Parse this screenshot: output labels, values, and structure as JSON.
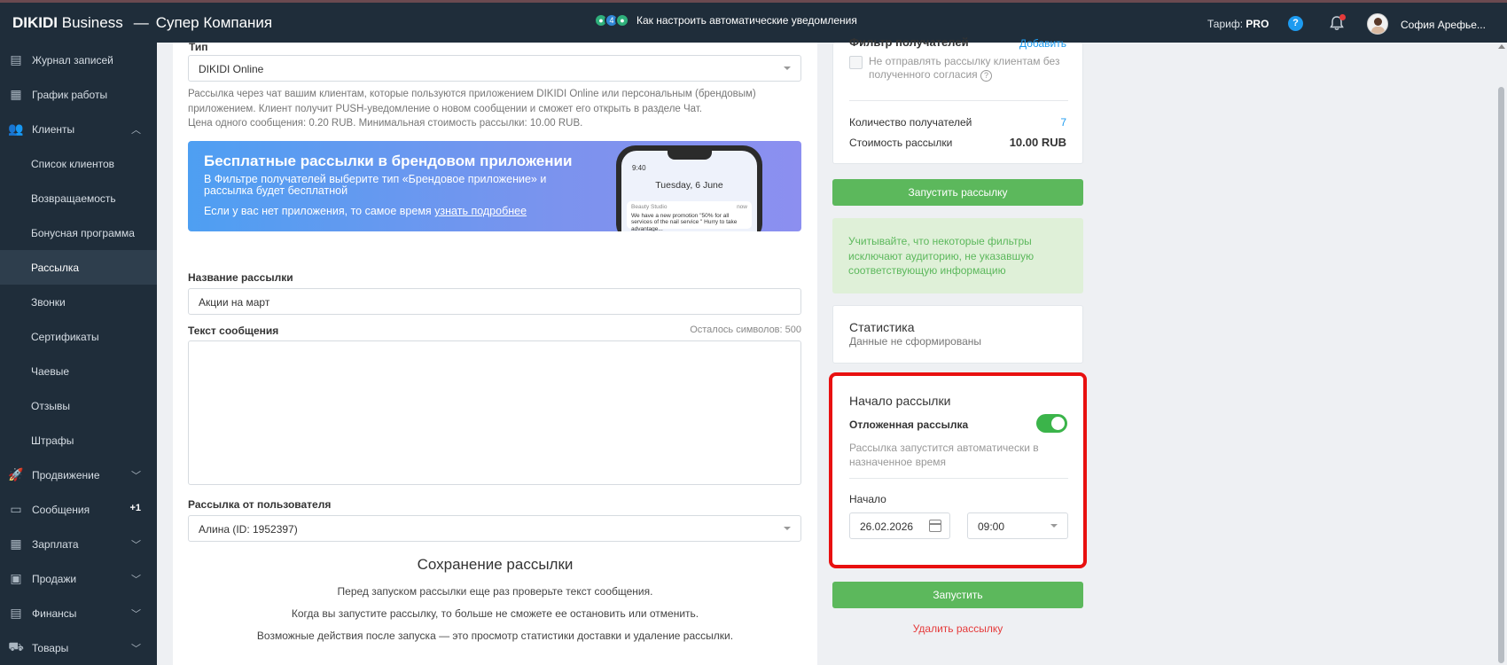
{
  "header": {
    "brand_bold": "DIKIDI",
    "brand_rest": "Business",
    "separator": "—",
    "company": "Супер Компания",
    "hint_text": "Как настроить автоматические уведомления",
    "tariff_label": "Тариф:",
    "tariff_value": "PRO",
    "help_glyph": "?",
    "user_name": "София Арефье..."
  },
  "sidebar": {
    "items": [
      {
        "label": "Журнал записей",
        "icon": "journal-icon"
      },
      {
        "label": "График работы",
        "icon": "calendar-icon"
      },
      {
        "label": "Клиенты",
        "icon": "clients-icon"
      },
      {
        "label": "Список клиентов"
      },
      {
        "label": "Возвращаемость"
      },
      {
        "label": "Бонусная программа"
      },
      {
        "label": "Рассылка"
      },
      {
        "label": "Звонки"
      },
      {
        "label": "Сертификаты"
      },
      {
        "label": "Чаевые"
      },
      {
        "label": "Отзывы"
      },
      {
        "label": "Штрафы"
      },
      {
        "label": "Продвижение",
        "icon": "rocket-icon"
      },
      {
        "label": "Сообщения",
        "icon": "messages-icon",
        "badge": "+1"
      },
      {
        "label": "Зарплата",
        "icon": "salary-icon"
      },
      {
        "label": "Продажи",
        "icon": "sales-icon"
      },
      {
        "label": "Финансы",
        "icon": "finance-icon"
      },
      {
        "label": "Товары",
        "icon": "goods-icon"
      }
    ]
  },
  "main": {
    "type_label": "Тип",
    "type_value": "DIKIDI Online",
    "type_desc_1": "Рассылка через чат вашим клиентам, которые пользуются приложением DIKIDI Online или персональным (брендовым) приложением. Клиент получит PUSH-уведомление о новом сообщении и сможет его открыть в разделе Чат.",
    "type_desc_2": "Цена одного сообщения: 0.20 RUB. Минимальная стоимость рассылки: 10.00 RUB.",
    "promo": {
      "title": "Бесплатные рассылки в брендовом приложении",
      "line1": "В Фильтре получателей выберите тип «Брендовое приложение» и рассылка будет бесплатной",
      "line2": "Если у вас нет приложения, то самое время",
      "link": "узнать подробнее",
      "phone_time": "9:40",
      "phone_date": "Tuesday, 6 June",
      "notif_app": "Beauty Studio",
      "notif_when": "now",
      "notif_text": "We have a new promotion \"50% for all services of the nail service \" Hurry to take advantage..."
    },
    "name_label": "Название рассылки",
    "name_value": "Акции на март",
    "text_label": "Текст сообщения",
    "counter": "Осталось символов: 500",
    "text_value": "",
    "from_label": "Рассылка от пользователя",
    "from_value": "Алина (ID: 1952397)",
    "save_title": "Сохранение рассылки",
    "save_line1": "Перед запуском рассылки еще раз проверьте текст сообщения.",
    "save_line2": "Когда вы запустите рассылку, то больше не сможете ее остановить или отменить.",
    "save_line3": "Возможные действия после запуска — это просмотр статистики доставки и удаление рассылки."
  },
  "right": {
    "filter_title": "Фильтр получателей",
    "filter_add": "Добавить",
    "consent_text": "Не отправлять рассылку клиентам без полученного согласия",
    "recipients_label": "Количество получателей",
    "recipients_value": "7",
    "cost_label": "Стоимость рассылки",
    "cost_value": "10.00 RUB",
    "start_broadcast_btn": "Запустить рассылку",
    "note": "Учитывайте, что некоторые фильтры исключают аудиторию, не указавшую соответствующую информацию",
    "stats_title": "Статистика",
    "stats_sub": "Данные не сформированы",
    "launch_title": "Начало рассылки",
    "deferred_label": "Отложенная рассылка",
    "deferred_on": true,
    "deferred_desc": "Рассылка запустится автоматически в назначенное время",
    "start_label": "Начало",
    "start_date": "26.02.2026",
    "start_time": "09:00",
    "launch_btn": "Запустить",
    "delete_link": "Удалить рассылку"
  },
  "colors": {
    "topbar": "#1f2d3a",
    "accent_green": "#5cb85c",
    "highlight_red": "#e81010",
    "link_blue": "#1d9bf0"
  }
}
